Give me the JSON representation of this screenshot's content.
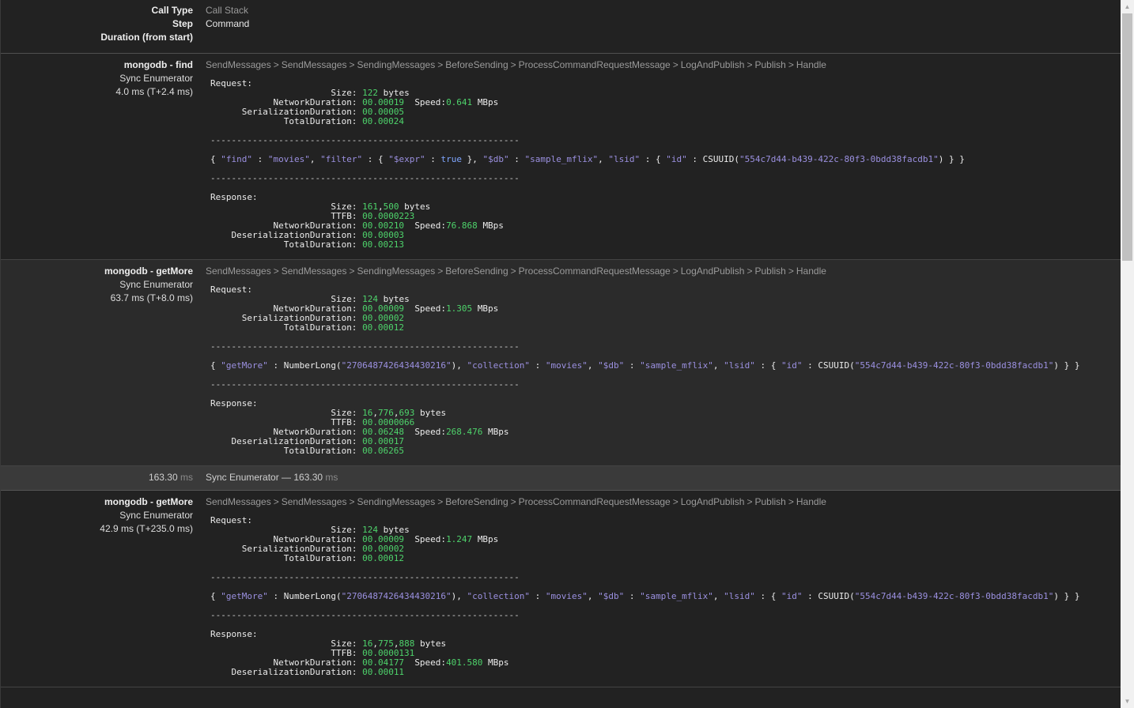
{
  "header": {
    "labels": [
      "Call Type",
      "Step",
      "Duration (from start)"
    ],
    "values": [
      "Call Stack",
      "Command"
    ]
  },
  "crumbs": [
    "SendMessages",
    "SendMessages",
    "SendingMessages",
    "BeforeSending",
    "ProcessCommandRequestMessage",
    "LogAndPublish",
    "Publish",
    "Handle"
  ],
  "crumb_sep": ">",
  "entries": [
    {
      "title": "mongodb - find",
      "type": "Sync Enumerator",
      "duration": "4.0 ms (T+2.4 ms)",
      "req": {
        "size_a": "122",
        "net": "00.00019",
        "speed": "0.641",
        "ser": "00.00005",
        "total": "00.00024"
      },
      "cmd": [
        [
          "p",
          "{ "
        ],
        [
          "s",
          "\"find\""
        ],
        [
          "p",
          " : "
        ],
        [
          "s",
          "\"movies\""
        ],
        [
          "p",
          ", "
        ],
        [
          "s",
          "\"filter\""
        ],
        [
          "p",
          " : { "
        ],
        [
          "s",
          "\"$expr\""
        ],
        [
          "p",
          " : "
        ],
        [
          "k",
          "true"
        ],
        [
          "p",
          " }, "
        ],
        [
          "s",
          "\"$db\""
        ],
        [
          "p",
          " : "
        ],
        [
          "s",
          "\"sample_mflix\""
        ],
        [
          "p",
          ", "
        ],
        [
          "s",
          "\"lsid\""
        ],
        [
          "p",
          " : { "
        ],
        [
          "s",
          "\"id\""
        ],
        [
          "p",
          " : CSUUID("
        ],
        [
          "s",
          "\"554c7d44-b439-422c-80f3-0bdd38facdb1\""
        ],
        [
          "p",
          ") } }"
        ]
      ],
      "resp": {
        "size": [
          "161",
          "500"
        ],
        "ttfb": "00.0000223",
        "net": "00.00210",
        "speed": "76.868",
        "deser": "00.00003",
        "total": "00.00213"
      }
    },
    {
      "title": "mongodb - getMore",
      "type": "Sync Enumerator",
      "duration": "63.7 ms (T+8.0 ms)",
      "req": {
        "size_a": "124",
        "net": "00.00009",
        "speed": "1.305",
        "ser": "00.00002",
        "total": "00.00012"
      },
      "cmd": [
        [
          "p",
          "{ "
        ],
        [
          "s",
          "\"getMore\""
        ],
        [
          "p",
          " : NumberLong("
        ],
        [
          "s",
          "\"2706487426434430216\""
        ],
        [
          "p",
          "), "
        ],
        [
          "s",
          "\"collection\""
        ],
        [
          "p",
          " : "
        ],
        [
          "s",
          "\"movies\""
        ],
        [
          "p",
          ", "
        ],
        [
          "s",
          "\"$db\""
        ],
        [
          "p",
          " : "
        ],
        [
          "s",
          "\"sample_mflix\""
        ],
        [
          "p",
          ", "
        ],
        [
          "s",
          "\"lsid\""
        ],
        [
          "p",
          " : { "
        ],
        [
          "s",
          "\"id\""
        ],
        [
          "p",
          " : CSUUID("
        ],
        [
          "s",
          "\"554c7d44-b439-422c-80f3-0bdd38facdb1\""
        ],
        [
          "p",
          ") } }"
        ]
      ],
      "resp": {
        "size": [
          "16",
          "776",
          "693"
        ],
        "ttfb": "00.0000066",
        "net": "00.06248",
        "speed": "268.476",
        "deser": "00.00017",
        "total": "00.06265"
      }
    },
    {
      "title": "mongodb - getMore",
      "type": "Sync Enumerator",
      "duration": "42.9 ms (T+235.0 ms)",
      "req": {
        "size_a": "124",
        "net": "00.00009",
        "speed": "1.247",
        "ser": "00.00002",
        "total": "00.00012"
      },
      "cmd": [
        [
          "p",
          "{ "
        ],
        [
          "s",
          "\"getMore\""
        ],
        [
          "p",
          " : NumberLong("
        ],
        [
          "s",
          "\"2706487426434430216\""
        ],
        [
          "p",
          "), "
        ],
        [
          "s",
          "\"collection\""
        ],
        [
          "p",
          " : "
        ],
        [
          "s",
          "\"movies\""
        ],
        [
          "p",
          ", "
        ],
        [
          "s",
          "\"$db\""
        ],
        [
          "p",
          " : "
        ],
        [
          "s",
          "\"sample_mflix\""
        ],
        [
          "p",
          ", "
        ],
        [
          "s",
          "\"lsid\""
        ],
        [
          "p",
          " : { "
        ],
        [
          "s",
          "\"id\""
        ],
        [
          "p",
          " : CSUUID("
        ],
        [
          "s",
          "\"554c7d44-b439-422c-80f3-0bdd38facdb1\""
        ],
        [
          "p",
          ") } }"
        ]
      ],
      "resp": {
        "size": [
          "16",
          "775",
          "888"
        ],
        "ttfb": "00.0000131",
        "net": "00.04177",
        "speed": "401.580",
        "deser": "00.00011",
        "total": ""
      }
    }
  ],
  "timing": {
    "left_value": "163.30",
    "unit": "ms",
    "label": "Sync Enumerator — ",
    "value": "163.30"
  },
  "labels": {
    "request": "Request:",
    "response": "Response:",
    "size": "Size:",
    "bytes": "bytes",
    "ttfb": "TTFB:",
    "network": "NetworkDuration:",
    "speed": "Speed:",
    "mbps": "MBps",
    "serialization": "SerializationDuration:",
    "deserialization": "DeserializationDuration:",
    "total": "TotalDuration:",
    "divider": "-----------------------------------------------------------"
  },
  "colors": {
    "background": "#222222",
    "value_green": "#4ed36b",
    "string_purple": "#9b90e0",
    "keyword_blue": "#7fa6ff"
  }
}
